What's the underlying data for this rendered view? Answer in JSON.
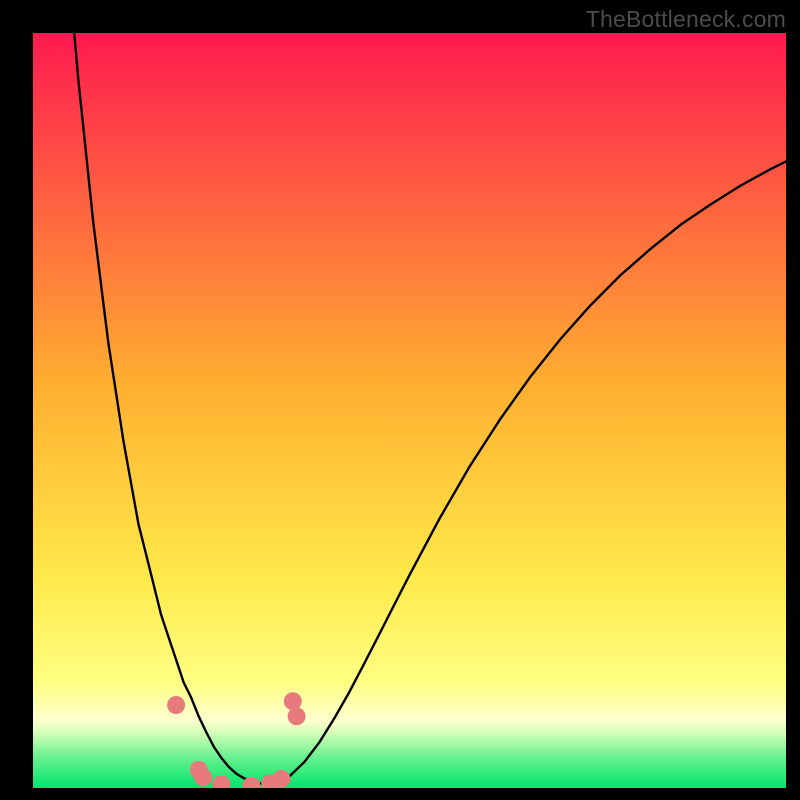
{
  "watermark": "TheBottleneck.com",
  "colors": {
    "frame": "#000000",
    "grad_top": "#ff1a4f",
    "grad_mid": "#ffc733",
    "grad_yellow": "#ffff66",
    "grad_paleyellow": "#ffffcc",
    "grad_green_top": "#a6ff9e",
    "grad_green_bot": "#00e56b",
    "curve": "#000000",
    "marker": "#e77b7b"
  },
  "chart_data": {
    "type": "line",
    "title": "",
    "xlabel": "",
    "ylabel": "",
    "xlim": [
      0,
      100
    ],
    "ylim": [
      0,
      100
    ],
    "x": [
      0,
      2,
      4,
      6,
      8,
      10,
      12,
      14,
      15,
      16,
      17,
      18,
      19,
      20,
      21,
      22,
      23,
      24,
      25,
      26,
      27,
      28,
      30,
      32,
      34,
      36,
      38,
      40,
      42,
      44,
      46,
      48,
      50,
      54,
      58,
      62,
      66,
      70,
      74,
      78,
      82,
      86,
      90,
      94,
      98,
      100
    ],
    "values": [
      178,
      145,
      117,
      94,
      75,
      59,
      46,
      35,
      31,
      27,
      23,
      20,
      17,
      14,
      12,
      9.5,
      7.4,
      5.5,
      4.0,
      2.8,
      1.9,
      1.3,
      0.6,
      0.6,
      1.5,
      3.4,
      6.0,
      9.2,
      12.7,
      16.5,
      20.4,
      24.3,
      28.2,
      35.7,
      42.6,
      48.8,
      54.4,
      59.4,
      63.9,
      67.9,
      71.4,
      74.6,
      77.3,
      79.8,
      82.0,
      83.0
    ],
    "minimum_x": 30,
    "markers": [
      {
        "x": 19.0,
        "y": 11.0
      },
      {
        "x": 22.0,
        "y": 2.4
      },
      {
        "x": 22.6,
        "y": 1.4
      },
      {
        "x": 25.0,
        "y": 0.5
      },
      {
        "x": 29.0,
        "y": 0.3
      },
      {
        "x": 31.5,
        "y": 0.6
      },
      {
        "x": 33.0,
        "y": 1.2
      },
      {
        "x": 34.5,
        "y": 11.5
      },
      {
        "x": 35.0,
        "y": 9.5
      }
    ]
  }
}
